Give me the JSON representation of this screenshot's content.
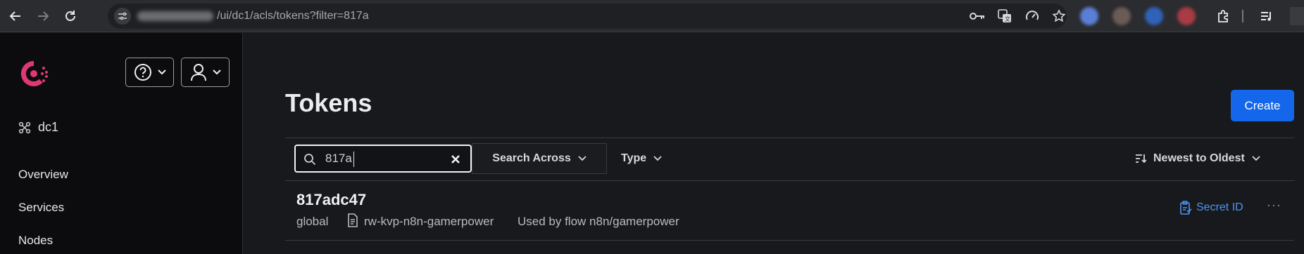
{
  "browser": {
    "url": "/ui/dc1/acls/tokens?filter=817a"
  },
  "sidebar": {
    "datacenter": "dc1",
    "items": [
      {
        "label": "Overview"
      },
      {
        "label": "Services"
      },
      {
        "label": "Nodes"
      }
    ]
  },
  "main": {
    "title": "Tokens",
    "create_label": "Create",
    "search": {
      "value": "817a"
    },
    "filters": {
      "search_across": "Search Across",
      "type": "Type",
      "sort": "Newest to Oldest"
    },
    "token": {
      "accessor": "817adc47",
      "scope": "global",
      "policy": "rw-kvp-n8n-gamerpower",
      "description": "Used by flow n8n/gamerpower",
      "secret_label": "Secret ID",
      "more": "···"
    }
  },
  "colors": {
    "accent": "#1466ea",
    "consul_brand": "#e03875",
    "link": "#4c95f5"
  }
}
